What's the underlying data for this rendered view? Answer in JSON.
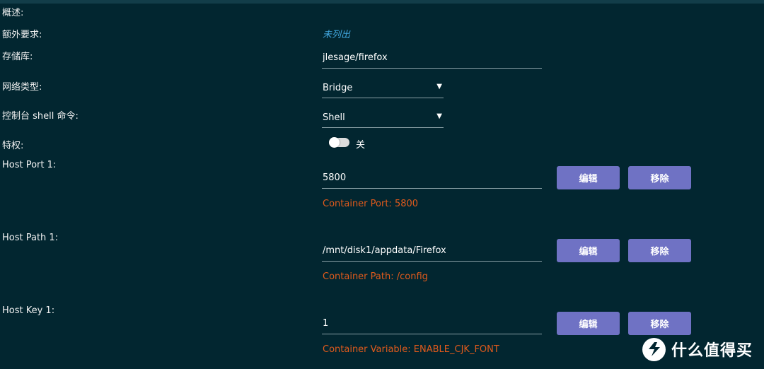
{
  "form": {
    "overview_label": "概述:",
    "extra_requirements": {
      "label": "额外要求:",
      "value": "未列出"
    },
    "repository": {
      "label": "存储库:",
      "value": "jlesage/firefox"
    },
    "network_type": {
      "label": "网络类型:",
      "value": "Bridge"
    },
    "console_shell": {
      "label": "控制台 shell 命令:",
      "value": "Shell"
    },
    "privileged": {
      "label": "特权:",
      "state_label": "关",
      "on": false
    }
  },
  "configs": [
    {
      "label": "Host Port 1:",
      "value": "5800",
      "hint": "Container Port: 5800",
      "edit_label": "编辑",
      "remove_label": "移除"
    },
    {
      "label": "Host Path 1:",
      "value": "/mnt/disk1/appdata/Firefox",
      "hint": "Container Path: /config",
      "edit_label": "编辑",
      "remove_label": "移除"
    },
    {
      "label": "Host Key 1:",
      "value": "1",
      "hint": "Container Variable: ENABLE_CJK_FONT",
      "edit_label": "编辑",
      "remove_label": "移除"
    }
  ],
  "watermark": {
    "text": "什么值得买",
    "icon": "zhi-logo-icon"
  },
  "colors": {
    "background": "#022630",
    "button": "#6f72c4",
    "hint": "#e05a1c",
    "placeholder": "#42a8e0"
  }
}
